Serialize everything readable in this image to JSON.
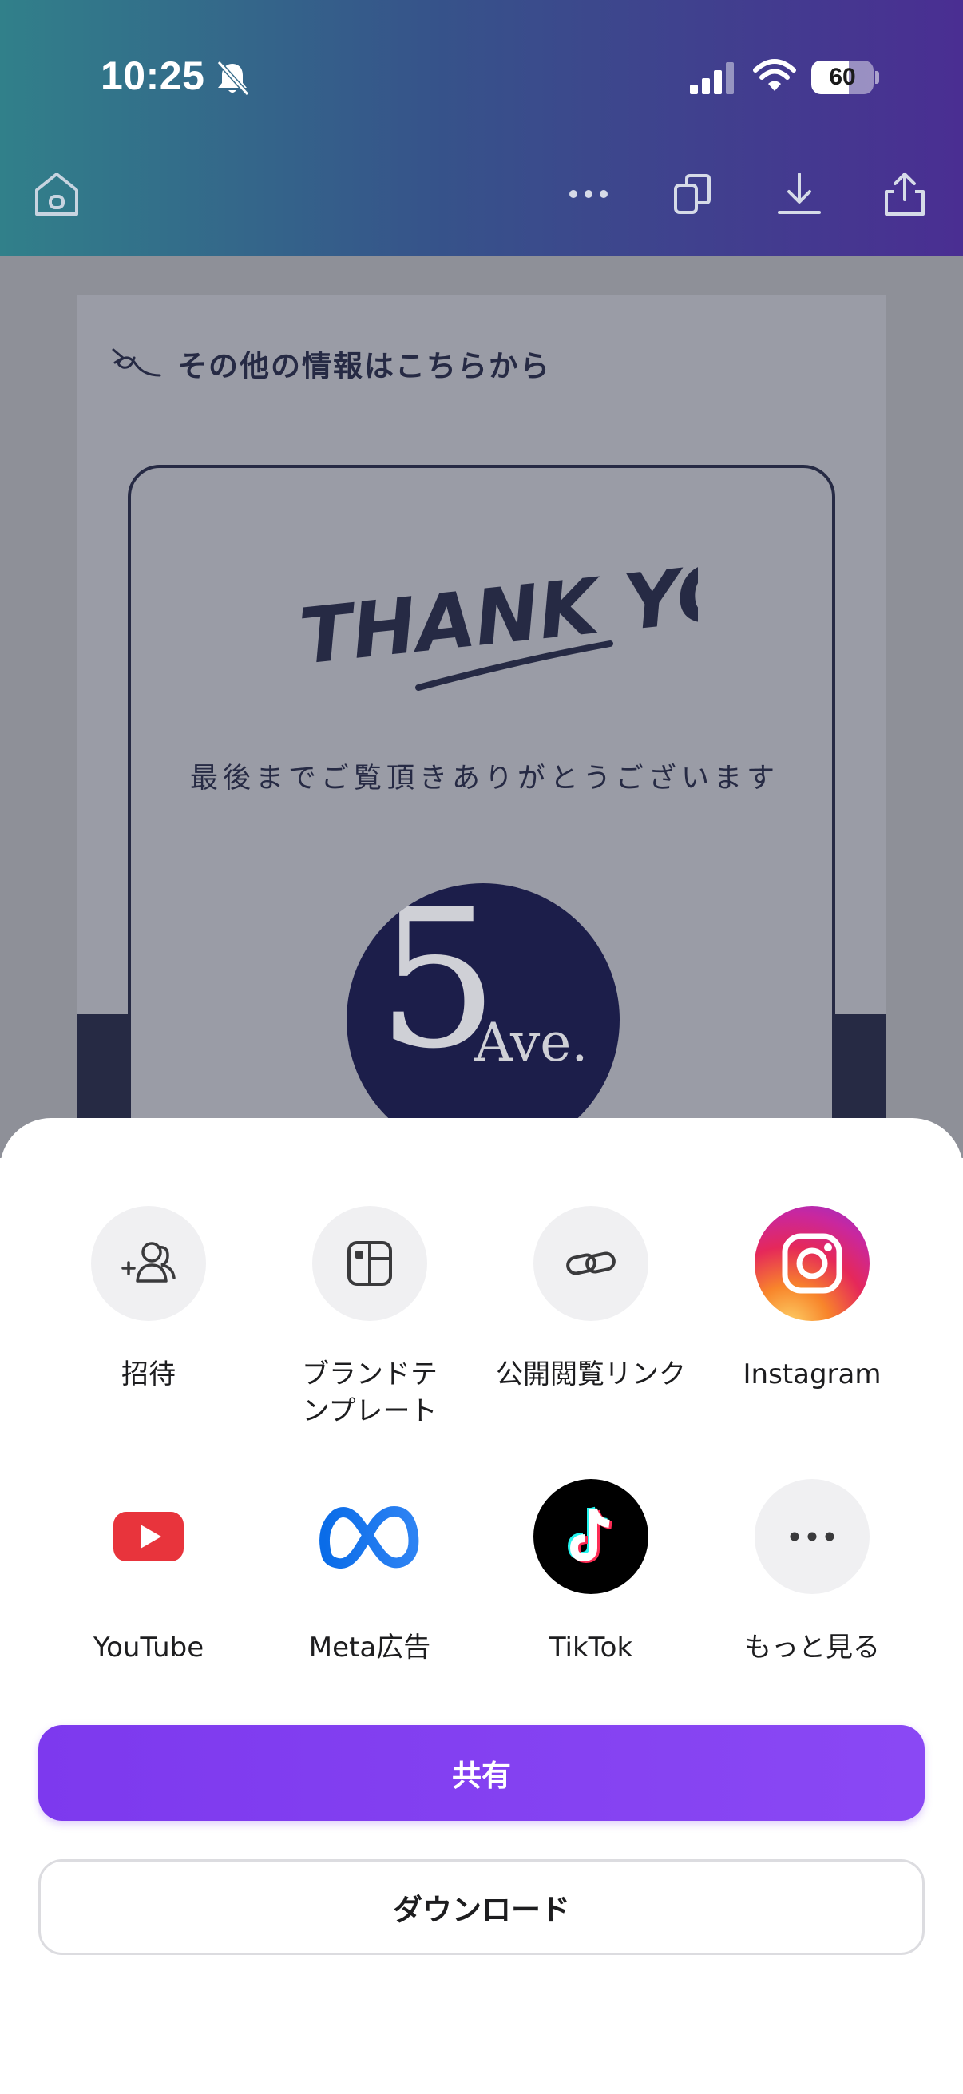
{
  "status_bar": {
    "time": "10:25",
    "battery_level": "60",
    "battery_fraction": 0.6,
    "icons": [
      "bell-slash-icon",
      "signal-icon",
      "wifi-icon",
      "battery-icon"
    ]
  },
  "toolbar": {
    "icons": [
      "home-icon",
      "more-horizontal-icon",
      "copy-pages-icon",
      "download-icon",
      "share-upload-icon"
    ]
  },
  "design": {
    "info_heading": "その他の情報はこちらから",
    "thank_you_art_text": "THANK YOU!",
    "message": "最後までご覧頂きありがとうございます",
    "logo_number": "5",
    "logo_text": "Ave."
  },
  "share_sheet": {
    "options": [
      {
        "label": "招待",
        "icon": "invite-people-icon"
      },
      {
        "label": "ブランドテンプレート",
        "label_line1": "ブランドテ",
        "label_line2": "ンプレート",
        "icon": "brand-template-icon"
      },
      {
        "label": "公開閲覧リンク",
        "icon": "link-icon"
      },
      {
        "label": "Instagram",
        "icon": "instagram-icon"
      },
      {
        "label": "YouTube",
        "icon": "youtube-icon"
      },
      {
        "label": "Meta広告",
        "icon": "meta-icon"
      },
      {
        "label": "TikTok",
        "icon": "tiktok-icon"
      },
      {
        "label": "もっと見る",
        "icon": "more-icon"
      }
    ],
    "share_button": "共有",
    "download_button": "ダウンロード"
  },
  "colors": {
    "header_gradient_start": "#31808a",
    "header_gradient_end": "#4a2e92",
    "accent_purple": "#7d39ee",
    "design_navy": "#262a44",
    "youtube_red": "#e8343c",
    "meta_blue": "#1877f2"
  }
}
